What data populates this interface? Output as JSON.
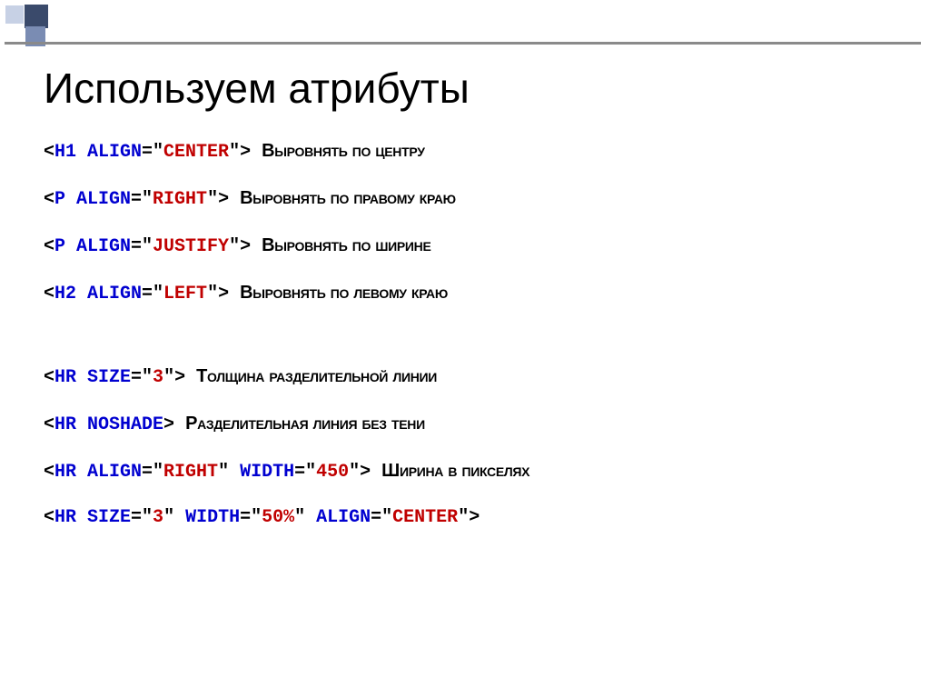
{
  "title": "Используем атрибуты",
  "lines": [
    {
      "parts": [
        {
          "cls": "black",
          "t": "<"
        },
        {
          "cls": "blue",
          "t": "H1 ALIGN"
        },
        {
          "cls": "black",
          "t": "=\""
        },
        {
          "cls": "red",
          "t": "CENTER"
        },
        {
          "cls": "black",
          "t": "\"> "
        }
      ],
      "comment": "Выровнять по центру"
    },
    {
      "parts": [
        {
          "cls": "black",
          "t": "<"
        },
        {
          "cls": "blue",
          "t": "P ALIGN"
        },
        {
          "cls": "black",
          "t": "=\""
        },
        {
          "cls": "red",
          "t": "RIGHT"
        },
        {
          "cls": "black",
          "t": "\"> "
        }
      ],
      "comment": "Выровнять по правому краю"
    },
    {
      "parts": [
        {
          "cls": "black",
          "t": "<"
        },
        {
          "cls": "blue",
          "t": "P ALIGN"
        },
        {
          "cls": "black",
          "t": "=\""
        },
        {
          "cls": "red",
          "t": "JUSTIFY"
        },
        {
          "cls": "black",
          "t": "\"> "
        }
      ],
      "comment": "Выровнять по ширине"
    },
    {
      "parts": [
        {
          "cls": "black",
          "t": "<"
        },
        {
          "cls": "blue",
          "t": "H2 ALIGN"
        },
        {
          "cls": "black",
          "t": "=\""
        },
        {
          "cls": "red",
          "t": "LEFT"
        },
        {
          "cls": "black",
          "t": "\"> "
        }
      ],
      "comment": "Выровнять по левому краю"
    },
    {
      "gap": true,
      "parts": [
        {
          "cls": "black",
          "t": "<"
        },
        {
          "cls": "blue",
          "t": "HR SIZE"
        },
        {
          "cls": "black",
          "t": "=\""
        },
        {
          "cls": "red",
          "t": "3"
        },
        {
          "cls": "black",
          "t": "\"> "
        }
      ],
      "comment": "Толщина разделительной линии"
    },
    {
      "parts": [
        {
          "cls": "black",
          "t": "<"
        },
        {
          "cls": "blue",
          "t": "HR NOSHADE"
        },
        {
          "cls": "black",
          "t": "> "
        }
      ],
      "comment": "Разделительная линия без тени"
    },
    {
      "parts": [
        {
          "cls": "black",
          "t": "<"
        },
        {
          "cls": "blue",
          "t": "HR ALIGN"
        },
        {
          "cls": "black",
          "t": "=\""
        },
        {
          "cls": "red",
          "t": "RIGHT"
        },
        {
          "cls": "black",
          "t": "\" "
        },
        {
          "cls": "blue",
          "t": "WIDTH"
        },
        {
          "cls": "black",
          "t": "=\""
        },
        {
          "cls": "red",
          "t": "450"
        },
        {
          "cls": "black",
          "t": "\"> "
        }
      ],
      "comment": "Ширина в пикселях"
    },
    {
      "parts": [
        {
          "cls": "black",
          "t": "<"
        },
        {
          "cls": "blue",
          "t": "HR SIZE"
        },
        {
          "cls": "black",
          "t": "=\""
        },
        {
          "cls": "red",
          "t": "3"
        },
        {
          "cls": "black",
          "t": "\" "
        },
        {
          "cls": "blue",
          "t": "WIDTH"
        },
        {
          "cls": "black",
          "t": "=\""
        },
        {
          "cls": "red",
          "t": "50%"
        },
        {
          "cls": "black",
          "t": "\" "
        },
        {
          "cls": "blue",
          "t": "ALIGN"
        },
        {
          "cls": "black",
          "t": "=\""
        },
        {
          "cls": "red",
          "t": "CENTER"
        },
        {
          "cls": "black",
          "t": "\">"
        }
      ],
      "comment": ""
    }
  ]
}
